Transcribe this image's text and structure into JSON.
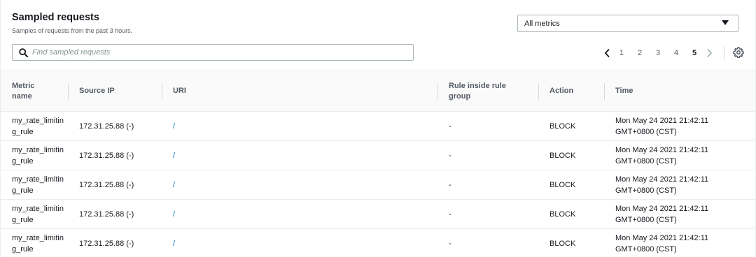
{
  "header": {
    "title": "Sampled requests",
    "subtitle": "Samples of requests from the past 3 hours."
  },
  "metrics_select": {
    "value": "All metrics"
  },
  "search": {
    "placeholder": "Find sampled requests",
    "value": ""
  },
  "pagination": {
    "pages": [
      "1",
      "2",
      "3",
      "4",
      "5"
    ],
    "current": "5"
  },
  "table": {
    "columns": {
      "metric": "Metric name",
      "source_ip": "Source IP",
      "uri": "URI",
      "rule_group": "Rule inside rule group",
      "action": "Action",
      "time": "Time"
    },
    "rows": [
      {
        "metric": "my_rate_limiting_rule",
        "source_ip": "172.31.25.88 (-)",
        "uri": "/",
        "rule_group": "-",
        "action": "BLOCK",
        "time": "Mon May 24 2021 21:42:11 GMT+0800 (CST)"
      },
      {
        "metric": "my_rate_limiting_rule",
        "source_ip": "172.31.25.88 (-)",
        "uri": "/",
        "rule_group": "-",
        "action": "BLOCK",
        "time": "Mon May 24 2021 21:42:11 GMT+0800 (CST)"
      },
      {
        "metric": "my_rate_limiting_rule",
        "source_ip": "172.31.25.88 (-)",
        "uri": "/",
        "rule_group": "-",
        "action": "BLOCK",
        "time": "Mon May 24 2021 21:42:11 GMT+0800 (CST)"
      },
      {
        "metric": "my_rate_limiting_rule",
        "source_ip": "172.31.25.88 (-)",
        "uri": "/",
        "rule_group": "-",
        "action": "BLOCK",
        "time": "Mon May 24 2021 21:42:11 GMT+0800 (CST)"
      },
      {
        "metric": "my_rate_limiting_rule",
        "source_ip": "172.31.25.88 (-)",
        "uri": "/",
        "rule_group": "-",
        "action": "BLOCK",
        "time": "Mon May 24 2021 21:42:11 GMT+0800 (CST)"
      }
    ]
  },
  "icons": {
    "search": "search-icon",
    "prev": "chevron-left-icon",
    "next": "chevron-right-icon",
    "settings": "gear-icon",
    "dropdown": "caret-down-icon"
  },
  "colors": {
    "link": "#0073bb",
    "text": "#16191f",
    "muted": "#545b64"
  }
}
